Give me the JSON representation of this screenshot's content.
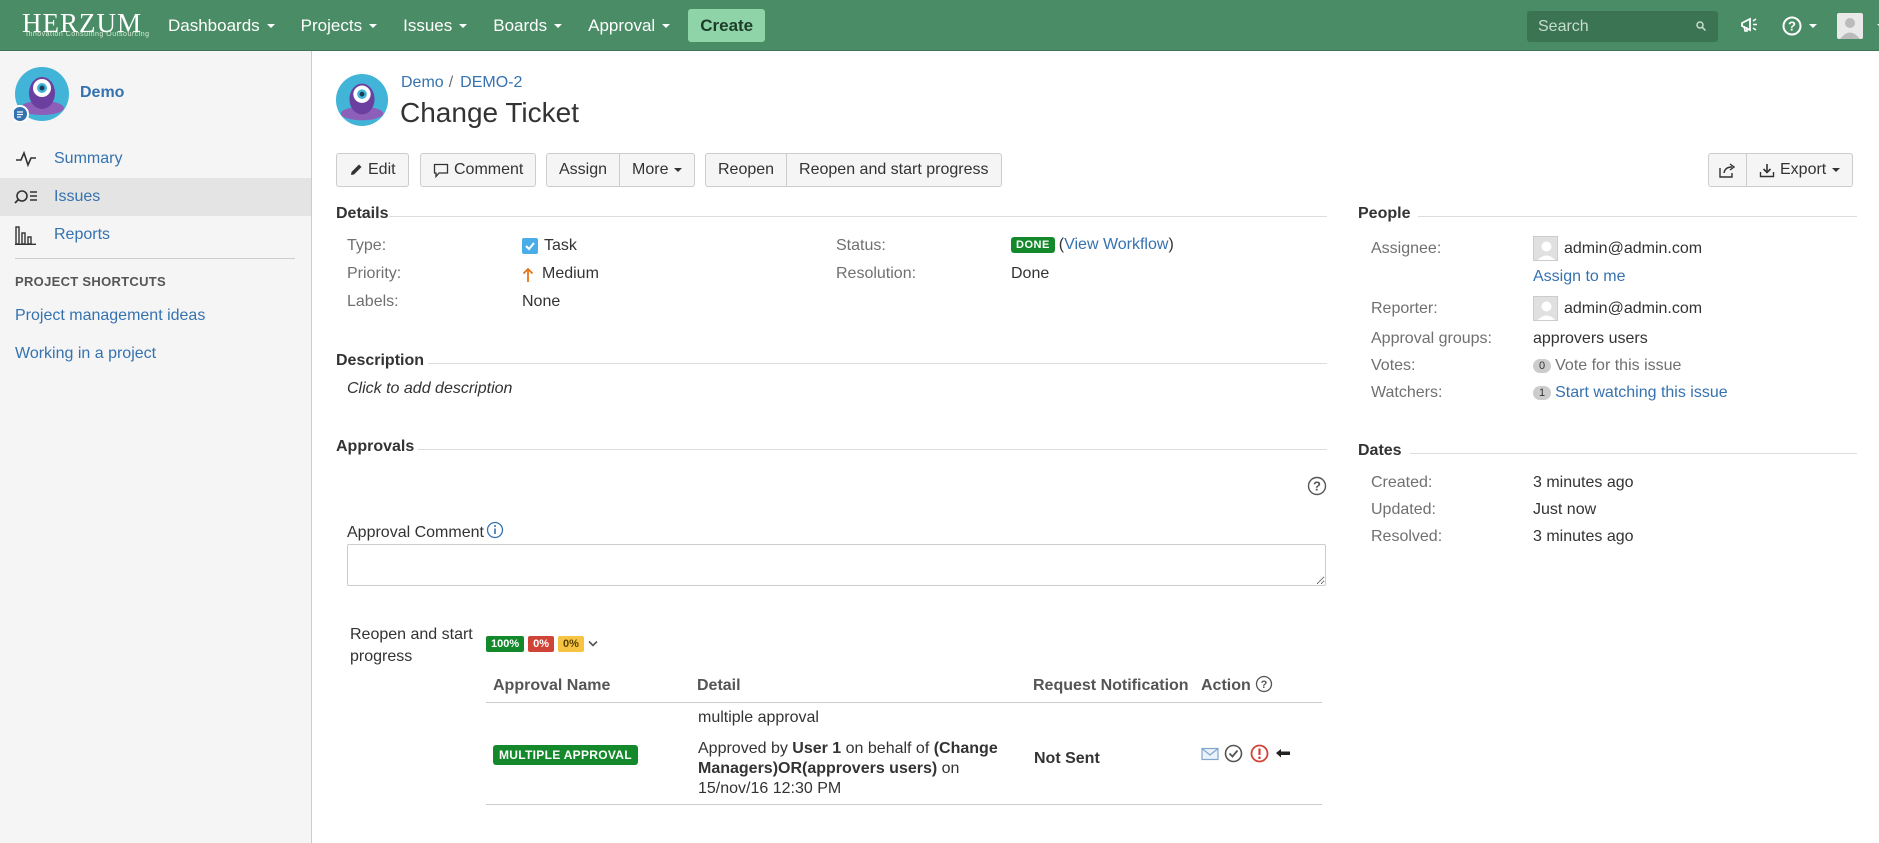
{
  "nav": {
    "logo": "HERZUM",
    "logo_tagline": "Innovation Consulting Outsourcing",
    "items": [
      "Dashboards",
      "Projects",
      "Issues",
      "Boards",
      "Approval"
    ],
    "create": "Create",
    "search_placeholder": "Search"
  },
  "sidebar": {
    "project_name": "Demo",
    "items": [
      "Summary",
      "Issues",
      "Reports"
    ],
    "shortcuts_title": "PROJECT SHORTCUTS",
    "shortcuts": [
      "Project management ideas",
      "Working in a project"
    ]
  },
  "issue": {
    "breadcrumb_project": "Demo",
    "breadcrumb_key": "DEMO-2",
    "title": "Change Ticket"
  },
  "toolbar": {
    "edit": "Edit",
    "comment": "Comment",
    "assign": "Assign",
    "more": "More",
    "reopen": "Reopen",
    "reopen_start": "Reopen and start progress",
    "export": "Export"
  },
  "details": {
    "heading": "Details",
    "type_label": "Type:",
    "type_value": "Task",
    "priority_label": "Priority:",
    "priority_value": "Medium",
    "labels_label": "Labels:",
    "labels_value": "None",
    "status_label": "Status:",
    "status_value": "DONE",
    "view_workflow": "View Workflow",
    "resolution_label": "Resolution:",
    "resolution_value": "Done"
  },
  "description": {
    "heading": "Description",
    "placeholder": "Click to add description"
  },
  "approvals": {
    "heading": "Approvals",
    "comment_label": "Approval Comment",
    "transition_line1": "Reopen and start",
    "transition_line2": "progress",
    "pct_green": "100%",
    "pct_red": "0%",
    "pct_yellow": "0%",
    "columns": [
      "Approval Name",
      "Detail",
      "Request Notification",
      "Action"
    ],
    "row": {
      "name": "MULTIPLE APPROVAL",
      "detail_top": "multiple approval",
      "detail_p1": "Approved by ",
      "detail_user": "User 1",
      "detail_p2": " on behalf of ",
      "detail_groups1": "(Change",
      "detail_groups2": "Managers)OR(approvers users)",
      "detail_p3": " on",
      "detail_date": "15/nov/16 12:30 PM",
      "notification": "Not Sent"
    }
  },
  "people": {
    "heading": "People",
    "assignee_label": "Assignee:",
    "assignee_value": "admin@admin.com",
    "assign_to_me": "Assign to me",
    "reporter_label": "Reporter:",
    "reporter_value": "admin@admin.com",
    "groups_label": "Approval groups:",
    "groups_value": "approvers users",
    "votes_label": "Votes:",
    "votes_count": "0",
    "votes_text": "Vote for this issue",
    "watchers_label": "Watchers:",
    "watchers_count": "1",
    "watchers_text": "Start watching this issue"
  },
  "dates": {
    "heading": "Dates",
    "created_label": "Created:",
    "created_value": "3 minutes ago",
    "updated_label": "Updated:",
    "updated_value": "Just now",
    "resolved_label": "Resolved:",
    "resolved_value": "3 minutes ago"
  },
  "colors": {
    "topbar": "#4a8c65",
    "link": "#3572b0",
    "success": "#14892c",
    "error": "#d04437",
    "warning": "#f6c342"
  }
}
